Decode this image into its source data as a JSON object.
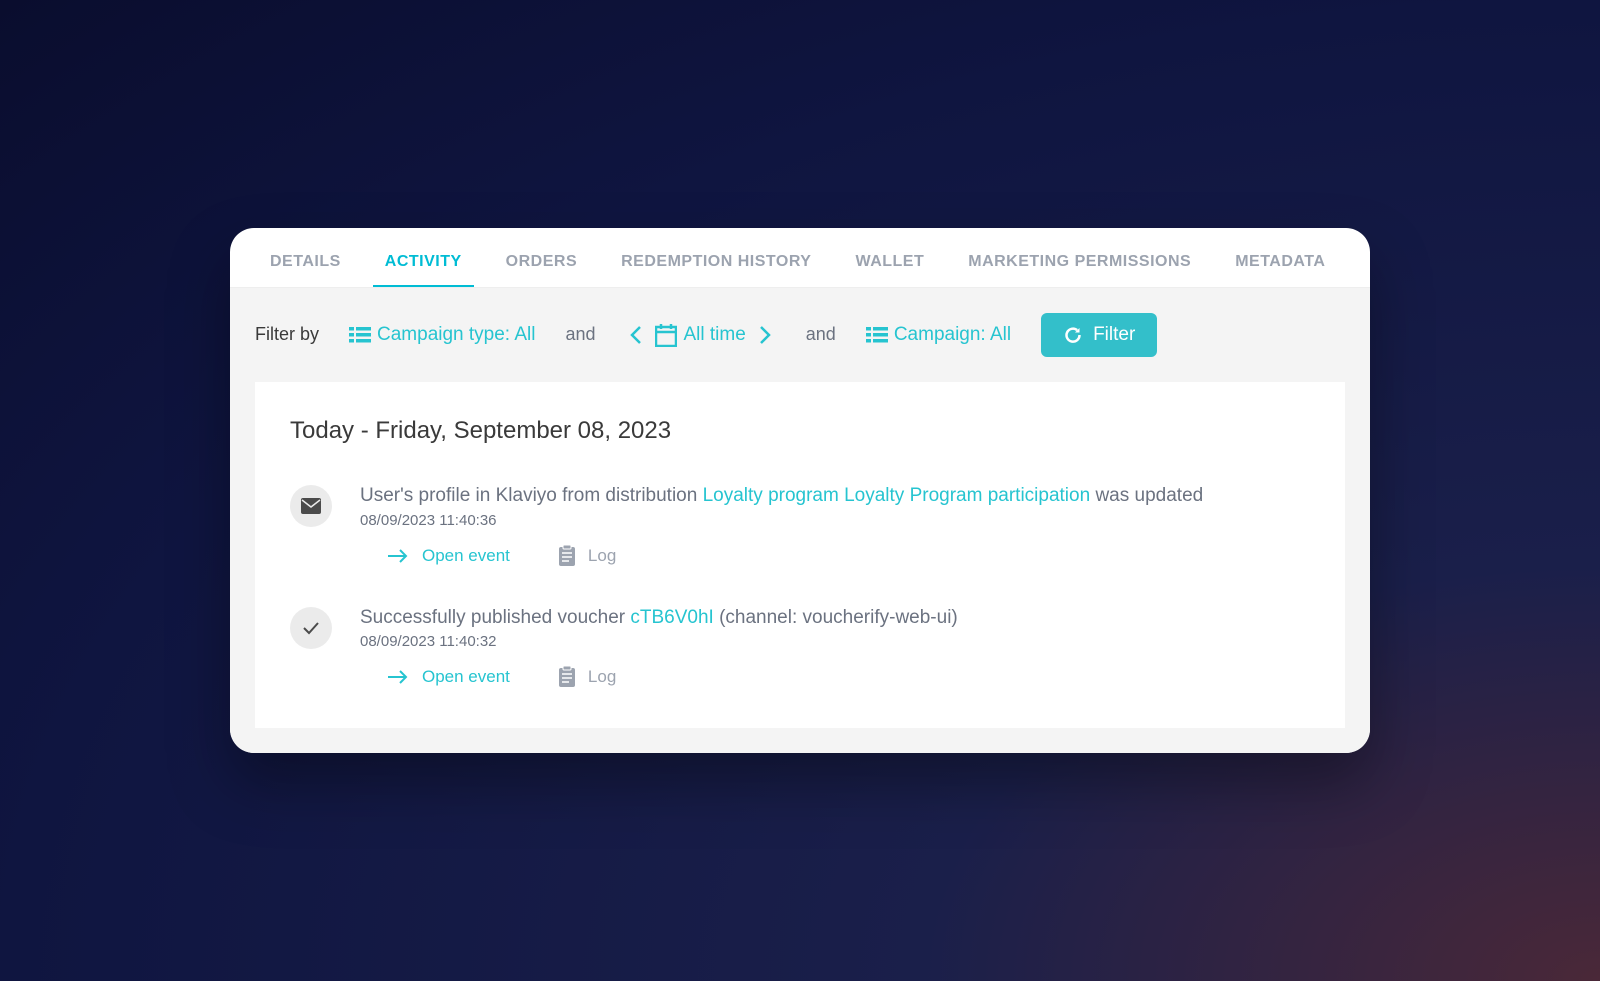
{
  "tabs": [
    {
      "label": "DETAILS",
      "active": false
    },
    {
      "label": "ACTIVITY",
      "active": true
    },
    {
      "label": "ORDERS",
      "active": false
    },
    {
      "label": "REDEMPTION HISTORY",
      "active": false
    },
    {
      "label": "WALLET",
      "active": false
    },
    {
      "label": "MARKETING PERMISSIONS",
      "active": false
    },
    {
      "label": "METADATA",
      "active": false
    }
  ],
  "filter": {
    "label": "Filter by",
    "campaign_type": "Campaign type: All",
    "and1": "and",
    "date_range": "All time",
    "and2": "and",
    "campaign": "Campaign: All",
    "button": "Filter"
  },
  "activity": {
    "date_heading": "Today - Friday, September 08, 2023",
    "events": [
      {
        "icon": "mail",
        "text_prefix": "User's profile in Klaviyo from distribution ",
        "link": "Loyalty program Loyalty Program participation",
        "text_suffix": " was updated",
        "timestamp": "08/09/2023 11:40:36",
        "open_label": "Open event",
        "log_label": "Log"
      },
      {
        "icon": "check",
        "text_prefix": "Successfully published voucher ",
        "link": "cTB6V0hI",
        "text_suffix": " (channel: voucherify-web-ui)",
        "timestamp": "08/09/2023 11:40:32",
        "open_label": "Open event",
        "log_label": "Log"
      }
    ]
  }
}
